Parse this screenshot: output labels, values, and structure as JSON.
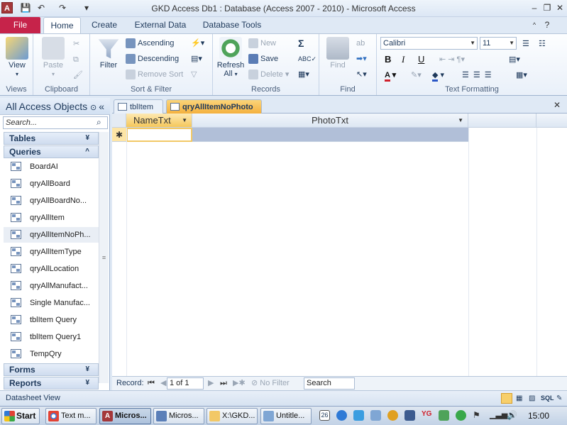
{
  "window": {
    "title": "GKD Access Db1 : Database (Access 2007 - 2010)  -  Microsoft Access",
    "app_icon": "A"
  },
  "ribbon_tabs": [
    {
      "label": "File"
    },
    {
      "label": "Home"
    },
    {
      "label": "Create"
    },
    {
      "label": "External Data"
    },
    {
      "label": "Database Tools"
    }
  ],
  "ribbon": {
    "views": {
      "label": "Views",
      "view": "View"
    },
    "clipboard": {
      "label": "Clipboard",
      "paste": "Paste"
    },
    "sort_filter": {
      "label": "Sort & Filter",
      "filter": "Filter",
      "ascending": "Ascending",
      "descending": "Descending",
      "remove_sort": "Remove Sort"
    },
    "records": {
      "label": "Records",
      "refresh": "Refresh",
      "refresh2": "All",
      "new": "New",
      "save": "Save",
      "delete": "Delete"
    },
    "find": {
      "label": "Find",
      "find": "Find"
    },
    "text_formatting": {
      "label": "Text Formatting",
      "font": "Calibri",
      "size": "11",
      "bold": "B",
      "italic": "I",
      "underline": "U"
    }
  },
  "nav": {
    "header": "All Access Objects",
    "search_placeholder": "Search...",
    "groups": {
      "tables": "Tables",
      "queries": "Queries",
      "forms": "Forms",
      "reports": "Reports"
    },
    "queries": [
      "BoardAI",
      "qryAllBoard",
      "qryAllBoardNo...",
      "qryAllItem",
      "qryAllItemNoPh...",
      "qryAllItemType",
      "qryAllLocation",
      "qryAllManufact...",
      "Single Manufac...",
      "tblItem Query",
      "tblItem Query1",
      "TempQry"
    ]
  },
  "doc_tabs": [
    {
      "label": "tblItem"
    },
    {
      "label": "qryAllItemNoPhoto"
    }
  ],
  "datasheet": {
    "columns": [
      "NameTxt",
      "PhotoTxt"
    ],
    "new_row_marker": "✱"
  },
  "record_nav": {
    "label": "Record:",
    "position": "1 of 1",
    "filter": "No Filter",
    "search": "Search"
  },
  "status": {
    "text": "Datasheet View",
    "sql": "SQL"
  },
  "taskbar": {
    "start": "Start",
    "buttons": [
      "Text m...",
      "Micros...",
      "Micros...",
      "X:\\GKD...",
      "Untitle..."
    ],
    "clock": "15:00",
    "date_badge": "26"
  },
  "colors": {
    "file_tab": "#c6234a",
    "active_tab": "#f4b03e",
    "accent": "#1e395b"
  }
}
